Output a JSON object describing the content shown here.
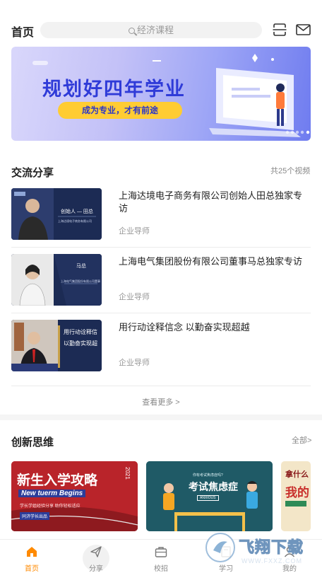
{
  "header": {
    "title": "首页",
    "search_placeholder": "经济课程",
    "scan_icon": "scan-icon",
    "mail_icon": "mail-icon"
  },
  "banner": {
    "title": "规划好四年学业",
    "subtitle": "成为专业，才有前途"
  },
  "share_section": {
    "title": "交流分享",
    "count": "共25个视频",
    "items": [
      {
        "title": "上海达境电子商务有限公司创始人田总独家专访",
        "tag": "企业导师",
        "thumb_caption": "创始人 — 田总",
        "thumb_sub": "上海达境电子商务有限公司"
      },
      {
        "title": "上海电气集团股份有限公司董事马总独家专访",
        "tag": "企业导师",
        "thumb_caption": "马总",
        "thumb_sub": "上海电气集团股份有限公司董事"
      },
      {
        "title": "用行动诠释信念 以勤奋实现超越",
        "tag": "企业导师",
        "thumb_caption": "用行动诠释信",
        "thumb_sub": "以勤奋实现超"
      }
    ],
    "see_more": "查看更多 >"
  },
  "innovation_section": {
    "title": "创新思维",
    "more": "全部>",
    "cards": [
      {
        "title": "新生入学攻略",
        "year": "2021",
        "en": "New tuerm Begins",
        "sub": "学长学姐经验分享 助你轻松适应",
        "tag": "同济学长出品"
      },
      {
        "title": "考试焦虑症",
        "question": "你有考试焦虑症吗?",
        "en": "ANXIOUS"
      },
      {
        "title": "拿什么",
        "line2": "我的"
      }
    ]
  },
  "tabbar": {
    "items": [
      {
        "label": "首页",
        "icon": "home-icon"
      },
      {
        "label": "分享",
        "icon": "send-icon"
      },
      {
        "label": "校招",
        "icon": "briefcase-icon"
      },
      {
        "label": "学习",
        "icon": "book-icon"
      },
      {
        "label": "我的",
        "icon": "user-icon"
      }
    ]
  },
  "watermark": {
    "text": "飞翔下载",
    "url": "WWW.FXXZ.COM"
  },
  "colors": {
    "accent": "#ff8a00",
    "banner_blue": "#2f3bd8",
    "banner_yellow": "#ffcc33"
  }
}
